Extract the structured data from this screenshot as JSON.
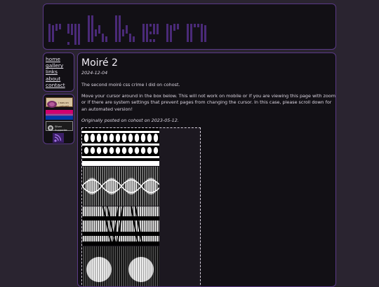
{
  "site": {
    "logo_text": "rykkern"
  },
  "nav": {
    "items": [
      "home",
      "gallery",
      "links",
      "about",
      "contact"
    ]
  },
  "badges": [
    {
      "name": "i-was-on-cohost-badge",
      "text": "i was on cohost!"
    },
    {
      "name": "bi-pride-flag-badge",
      "text": ""
    },
    {
      "name": "silver-supporter-badge",
      "text": "Silver Supporter"
    },
    {
      "name": "rss-feed-badge",
      "text": ""
    }
  ],
  "post": {
    "title": "Moiré 2",
    "date": "2024-12-04",
    "intro": "The second moiré css crime I did on cohost.",
    "instructions": "Move your cursor around in the box below. This will not work on mobile or if you are viewing this page with zoom or if there are system settings that prevent pages from changing the cursor. In this case, please scroll down for an automated version!",
    "origin": "Originally posted on cohost on 2023-05-12."
  },
  "colors": {
    "page_bg": "#2a2430",
    "panel_bg": "#121015",
    "border": "#5a3a86",
    "logo": "#4a2a78"
  }
}
